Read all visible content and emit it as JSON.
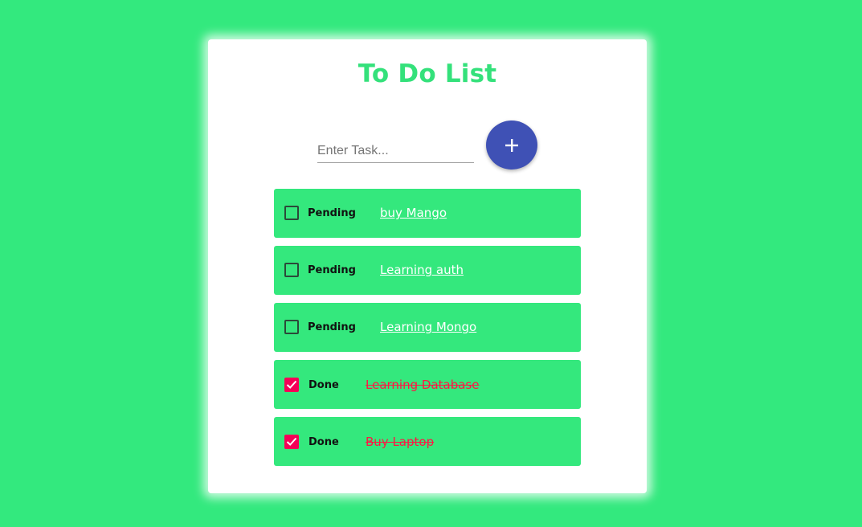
{
  "app": {
    "title": "To Do List"
  },
  "form": {
    "placeholder": "Enter Task...",
    "value": "",
    "add_icon": "plus-icon"
  },
  "tasks": [
    {
      "status": "Pending",
      "text": "buy Mango",
      "done": false
    },
    {
      "status": "Pending",
      "text": "Learning auth",
      "done": false
    },
    {
      "status": "Pending",
      "text": "Learning Mongo",
      "done": false
    },
    {
      "status": "Done",
      "text": "Learning Database",
      "done": true
    },
    {
      "status": "Done",
      "text": "Buy Laptop",
      "done": true
    }
  ],
  "colors": {
    "background": "#33e97e",
    "title": "#34e17b",
    "add_button": "#3f51b5",
    "item_background": "#34e87d",
    "checked": "#f50057",
    "done_text": "#ff1744"
  }
}
